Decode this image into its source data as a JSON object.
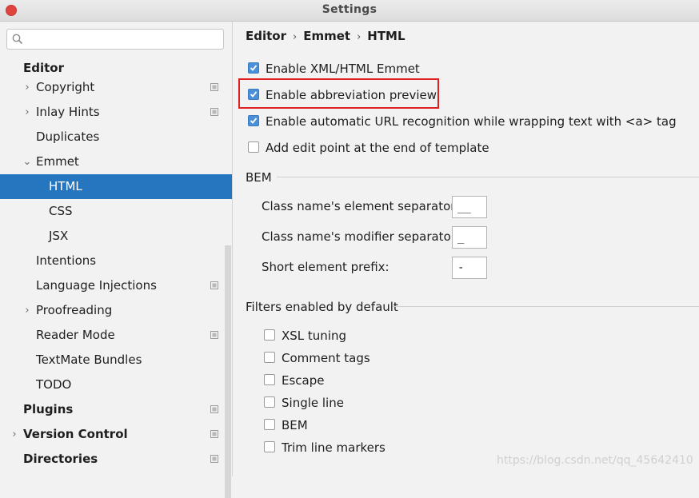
{
  "window": {
    "title": "Settings"
  },
  "sidebar": {
    "search_placeholder": "",
    "items": [
      {
        "label": "Editor",
        "kind": "group"
      },
      {
        "label": "Copyright",
        "expandable": true,
        "project_icon": true
      },
      {
        "label": "Inlay Hints",
        "expandable": true,
        "project_icon": true
      },
      {
        "label": "Duplicates"
      },
      {
        "label": "Emmet",
        "expanded": true
      },
      {
        "label": "HTML",
        "selected": true
      },
      {
        "label": "CSS"
      },
      {
        "label": "JSX"
      },
      {
        "label": "Intentions"
      },
      {
        "label": "Language Injections",
        "project_icon": true
      },
      {
        "label": "Proofreading",
        "expandable": true
      },
      {
        "label": "Reader Mode",
        "project_icon": true
      },
      {
        "label": "TextMate Bundles"
      },
      {
        "label": "TODO"
      },
      {
        "label": "Plugins",
        "kind": "group",
        "project_icon": true
      },
      {
        "label": "Version Control",
        "kind": "group",
        "expandable": true,
        "project_icon": true
      },
      {
        "label": "Directories",
        "kind": "group",
        "project_icon": true
      }
    ]
  },
  "breadcrumb": [
    "Editor",
    "Emmet",
    "HTML"
  ],
  "options": [
    {
      "label": "Enable XML/HTML Emmet",
      "checked": true
    },
    {
      "label": "Enable abbreviation preview",
      "checked": true
    },
    {
      "label": "Enable automatic URL recognition while wrapping text with <a> tag",
      "checked": true
    },
    {
      "label": "Add edit point at the end of template",
      "checked": false
    }
  ],
  "bem": {
    "title": "BEM",
    "fields": [
      {
        "label": "Class name's element separator:",
        "value": "__"
      },
      {
        "label": "Class name's modifier separator:",
        "value": "_"
      },
      {
        "label": "Short element prefix:",
        "value": "-"
      }
    ]
  },
  "filters": {
    "title": "Filters enabled by default",
    "items": [
      {
        "label": "XSL tuning",
        "checked": false
      },
      {
        "label": "Comment tags",
        "checked": false
      },
      {
        "label": "Escape",
        "checked": false
      },
      {
        "label": "Single line",
        "checked": false
      },
      {
        "label": "BEM",
        "checked": false
      },
      {
        "label": "Trim line markers",
        "checked": false
      }
    ]
  },
  "watermark": "https://blog.csdn.net/qq_45642410",
  "colors": {
    "selection": "#2675bf",
    "checkbox_checked": "#4a90d9",
    "highlight_border": "#e02020",
    "close_button": "#e0443e"
  }
}
